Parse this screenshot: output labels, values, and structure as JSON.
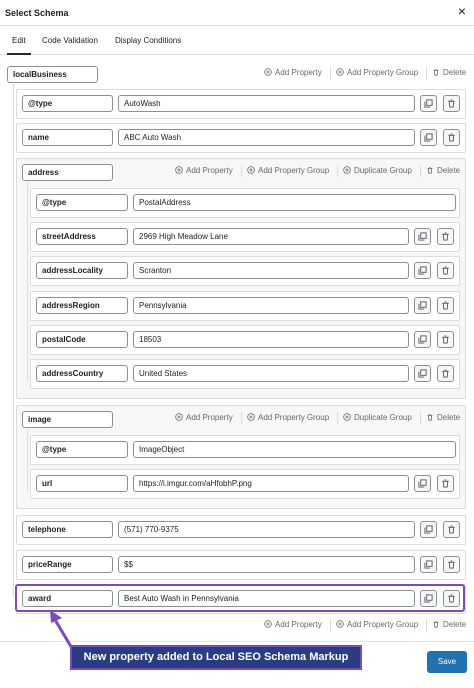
{
  "modal": {
    "title": "Select Schema",
    "close_glyph": "×"
  },
  "tabs": [
    {
      "label": "Edit",
      "active": true
    },
    {
      "label": "Code Validation",
      "active": false
    },
    {
      "label": "Display Conditions",
      "active": false
    }
  ],
  "root": {
    "key": "localBusiness"
  },
  "actions": {
    "add_property": "Add Property",
    "add_property_group": "Add Property Group",
    "duplicate_group": "Duplicate Group",
    "delete": "Delete"
  },
  "properties": {
    "type": {
      "key": "@type",
      "value": "AutoWash"
    },
    "name": {
      "key": "name",
      "value": "ABC Auto Wash"
    },
    "telephone": {
      "key": "telephone",
      "value": "(571) 770-9375"
    },
    "price_range": {
      "key": "priceRange",
      "value": "$$"
    },
    "award": {
      "key": "award",
      "value": "Best Auto Wash in Pennsylvania"
    }
  },
  "address": {
    "key": "address",
    "rows": [
      {
        "key": "@type",
        "value": "PostalAddress"
      },
      {
        "key": "streetAddress",
        "value": "2969 High Meadow Lane"
      },
      {
        "key": "addressLocality",
        "value": "Scranton"
      },
      {
        "key": "addressRegion",
        "value": "Pennsylvania"
      },
      {
        "key": "postalCode",
        "value": "18503"
      },
      {
        "key": "addressCountry",
        "value": "United States"
      }
    ]
  },
  "image": {
    "key": "image",
    "rows": [
      {
        "key": "@type",
        "value": "ImageObject"
      },
      {
        "key": "url",
        "value": "https://i.imgur.com/aHfobhP.png"
      }
    ]
  },
  "callout": {
    "text": "New property added to Local SEO Schema Markup"
  },
  "footer": {
    "save_label": "Save"
  },
  "colors": {
    "accent": "#7b4bb7",
    "callout_bg": "#2b3d82",
    "primary_button": "#2271b1"
  }
}
